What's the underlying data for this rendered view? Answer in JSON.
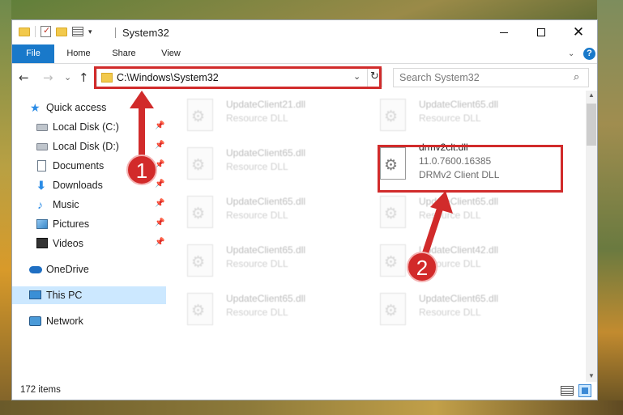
{
  "window": {
    "title": "System32",
    "quick_access_toolbar": {
      "icons": [
        "folder-icon",
        "properties-icon",
        "new-folder-icon",
        "views-icon"
      ],
      "dropdown_glyph": "▾"
    },
    "controls": {
      "minimize": "minimize",
      "maximize": "maximize",
      "close": "✕"
    }
  },
  "ribbon": {
    "tabs": [
      "File",
      "Home",
      "Share",
      "View"
    ],
    "help_label": "?",
    "expand_glyph": "⌄"
  },
  "nav": {
    "back": "←",
    "forward": "→",
    "recent": "⌄",
    "up": "↑",
    "address": "C:\\Windows\\System32",
    "address_dropdown": "⌄",
    "refresh": "↻",
    "search_placeholder": "Search System32",
    "search_icon": "⌕"
  },
  "sidebar": {
    "items": [
      {
        "label": "Quick access",
        "icon": "star-icon",
        "pinned": false,
        "selected": false
      },
      {
        "label": "Local Disk (C:)",
        "icon": "disk-icon",
        "pinned": true,
        "selected": false
      },
      {
        "label": "Local Disk (D:)",
        "icon": "disk-icon",
        "pinned": true,
        "selected": false
      },
      {
        "label": "Documents",
        "icon": "document-icon",
        "pinned": true,
        "selected": false
      },
      {
        "label": "Downloads",
        "icon": "download-icon",
        "pinned": true,
        "selected": false
      },
      {
        "label": "Music",
        "icon": "music-icon",
        "pinned": true,
        "selected": false
      },
      {
        "label": "Pictures",
        "icon": "pictures-icon",
        "pinned": true,
        "selected": false
      },
      {
        "label": "Videos",
        "icon": "video-icon",
        "pinned": true,
        "selected": false
      },
      {
        "label": "OneDrive",
        "icon": "cloud-icon",
        "pinned": false,
        "selected": false
      },
      {
        "label": "This PC",
        "icon": "computer-icon",
        "pinned": false,
        "selected": true
      },
      {
        "label": "Network",
        "icon": "network-icon",
        "pinned": false,
        "selected": false
      }
    ],
    "pin_glyph": "📌"
  },
  "files": {
    "left_column": [
      {
        "name": "UpdateClient21.dll",
        "desc": "Resource DLL"
      },
      {
        "name": "UpdateClient65.dll",
        "desc": "Resource DLL"
      },
      {
        "name": "UpdateClient65.dll",
        "desc": "Resource DLL"
      },
      {
        "name": "UpdateClient65.dll",
        "desc": "Resource DLL"
      },
      {
        "name": "UpdateClient65.dll",
        "desc": "Resource DLL"
      }
    ],
    "right_column": [
      {
        "name": "UpdateClient65.dll",
        "desc": "Resource DLL"
      },
      {
        "name": "UpdateClient65.dll",
        "desc": "Resource DLL"
      },
      {
        "name": "UpdateClient42.dll",
        "desc": "Resource DLL"
      },
      {
        "name": "UpdateClient65.dll",
        "desc": "Resource DLL"
      }
    ],
    "highlighted": {
      "name": "drmv2clt.dll",
      "version": "11.0.7600.16385",
      "desc": "DRMv2 Client DLL"
    }
  },
  "status": {
    "item_count": "172 items"
  },
  "annotations": {
    "badge_1": "1",
    "badge_2": "2",
    "color": "#d12b2b"
  },
  "colors": {
    "accent": "#1979ca",
    "selection": "#cce8ff"
  }
}
